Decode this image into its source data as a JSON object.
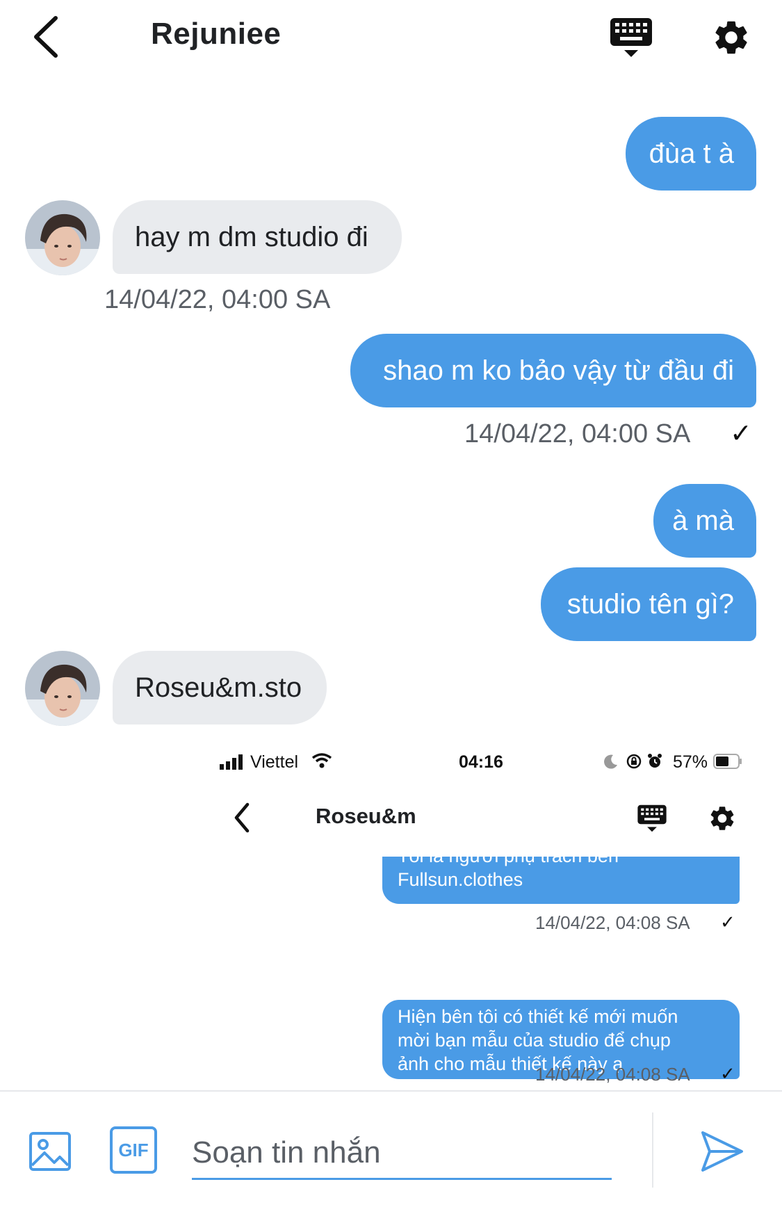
{
  "header": {
    "back_icon": "chevron-left-icon",
    "title": "Rejuniee",
    "keyboard_icon": "keyboard-icon",
    "settings_icon": "gear-icon"
  },
  "messages": [
    {
      "dir": "out",
      "text": "đùa t à"
    },
    {
      "dir": "in",
      "text": "hay m dm studio đi",
      "time": "14/04/22, 04:00 SA"
    },
    {
      "dir": "out",
      "text": "shao m ko bảo vậy từ đầu đi",
      "time": "14/04/22, 04:00 SA",
      "status": "✓"
    },
    {
      "dir": "out",
      "text": "à mà"
    },
    {
      "dir": "out",
      "text": "studio tên gì?"
    },
    {
      "dir": "in",
      "text": "Roseu&m.sto"
    }
  ],
  "embedded": {
    "status_bar": {
      "carrier": "Viettel",
      "time": "04:16",
      "battery": "57%"
    },
    "title": "Roseu&m",
    "messages": [
      {
        "text_cut": "Tôi là người phụ trách bên",
        "text": "Fullsun.clothes",
        "time": "14/04/22, 04:08 SA",
        "status": "✓"
      },
      {
        "line1": "Hiện bên tôi có thiết kế mới muốn",
        "line2": "mời bạn mẫu của studio để chụp",
        "line3": "ảnh cho mẫu thiết kế này ạ",
        "time": "14/04/22, 04:08 SA",
        "status": "✓"
      }
    ]
  },
  "composer": {
    "placeholder": "Soạn tin nhắn",
    "image_icon": "image-icon",
    "gif_label": "GIF",
    "send_icon": "send-icon"
  },
  "colors": {
    "accent": "#4a9be6",
    "incoming": "#e9ebee",
    "muted": "#5a5f66"
  }
}
